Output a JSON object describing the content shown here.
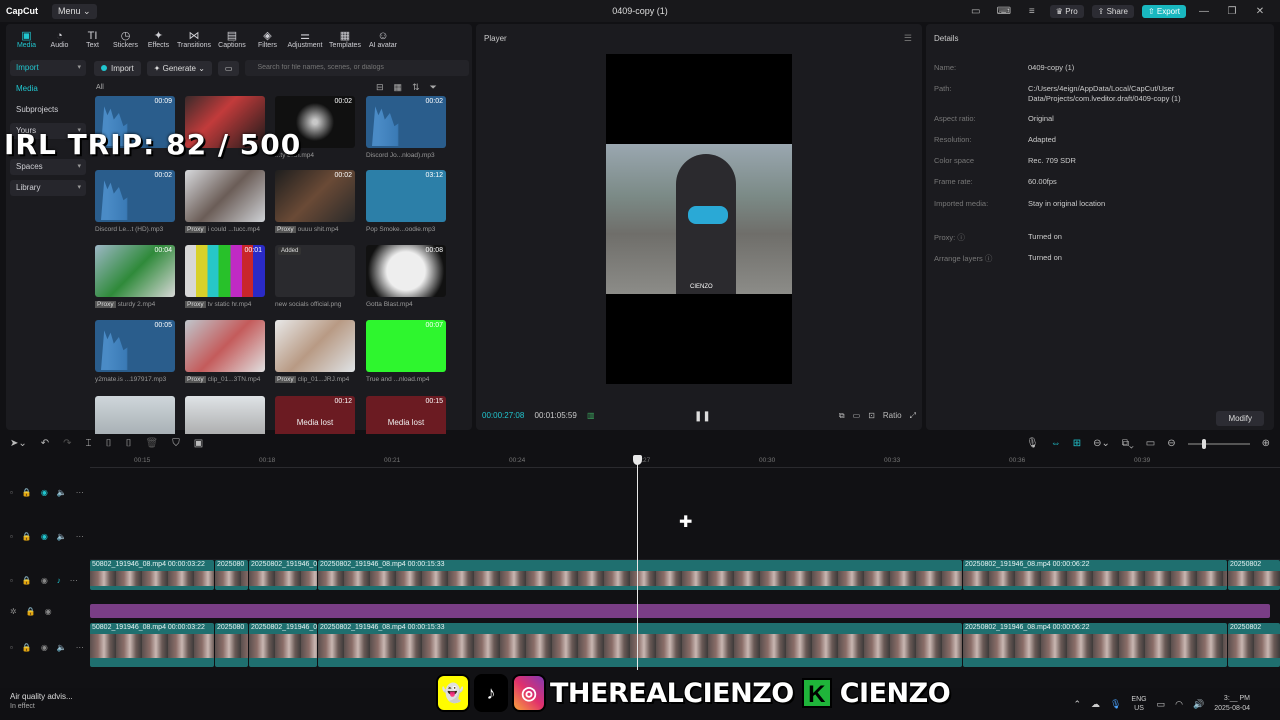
{
  "app": {
    "logo": "CapCut",
    "menu_label": "Menu",
    "title": "0409-copy (1)",
    "pro_label": "Pro",
    "share_label": "Share",
    "export_label": "Export",
    "accent_color": "#19b7bf"
  },
  "toolbar": {
    "items": [
      {
        "label": "Media",
        "icon": "media-icon"
      },
      {
        "label": "Audio",
        "icon": "audio-icon"
      },
      {
        "label": "Text",
        "icon": "text-icon"
      },
      {
        "label": "Stickers",
        "icon": "sticker-icon"
      },
      {
        "label": "Effects",
        "icon": "effects-icon"
      },
      {
        "label": "Transitions",
        "icon": "transitions-icon"
      },
      {
        "label": "Captions",
        "icon": "captions-icon"
      },
      {
        "label": "Filters",
        "icon": "filters-icon"
      },
      {
        "label": "Adjustment",
        "icon": "adjustment-icon"
      },
      {
        "label": "Templates",
        "icon": "templates-icon"
      },
      {
        "label": "AI avatar",
        "icon": "ai-avatar-icon"
      }
    ]
  },
  "sidebar": {
    "items": [
      {
        "label": "Import"
      },
      {
        "label": "Media"
      },
      {
        "label": "Subprojects"
      },
      {
        "label": "Yours"
      },
      {
        "label": "Spaces"
      },
      {
        "label": "Library"
      }
    ]
  },
  "media": {
    "import_label": "Import",
    "generate_label": "Generate",
    "search_placeholder": "Search for file names, scenes, or dialogs",
    "filter_label": "All",
    "proxy_tag": "Proxy",
    "added_tag": "Added",
    "items": [
      {
        "name": "",
        "duration": "00:09"
      },
      {
        "name": "",
        "duration": ""
      },
      {
        "name": "...ty btch.mp4",
        "duration": "00:02"
      },
      {
        "name": "Discord Jo...nload).mp3",
        "duration": "00:02"
      },
      {
        "name": "Discord Le...t (HD).mp3",
        "duration": "00:02"
      },
      {
        "name": "i could ...tucc.mp4",
        "duration": ""
      },
      {
        "name": "ouuu shit.mp4",
        "duration": "00:02"
      },
      {
        "name": "Pop Smoke...oodie.mp3",
        "duration": "03:12"
      },
      {
        "name": "sturdy 2.mp4",
        "duration": "00:04"
      },
      {
        "name": "tv static hr.mp4",
        "duration": "00:01"
      },
      {
        "name": "new socials official.png",
        "duration": ""
      },
      {
        "name": "Gotta Blast.mp4",
        "duration": "00:08"
      },
      {
        "name": "y2mate.is ...197917.mp3",
        "duration": "00:05"
      },
      {
        "name": "clip_01...3TN.mp4",
        "duration": ""
      },
      {
        "name": "clip_01...JRJ.mp4",
        "duration": ""
      },
      {
        "name": "True and ...nload.mp4",
        "duration": "00:07"
      },
      {
        "name": "",
        "duration": ""
      },
      {
        "name": "",
        "duration": ""
      },
      {
        "name": "Media lost",
        "duration": "00:12"
      },
      {
        "name": "Media lost",
        "duration": "00:15"
      }
    ]
  },
  "overlay": {
    "irl_text": "IRL TRIP:  82 / 500",
    "handle_1": "THEREALCIENZO",
    "handle_k": "K",
    "handle_2": "CIENZO"
  },
  "player": {
    "title": "Player",
    "current_time": "00:00:27:08",
    "total_time": "00:01:05:59",
    "ratio_label": "Ratio",
    "watermark": "CIENZO"
  },
  "details": {
    "title": "Details",
    "rows": [
      {
        "label": "Name:",
        "value": "0409-copy (1)"
      },
      {
        "label": "Path:",
        "value": "C:/Users/4eign/AppData/Local/CapCut/User Data/Projects/com.lveditor.draft/0409-copy (1)"
      },
      {
        "label": "Aspect ratio:",
        "value": "Original"
      },
      {
        "label": "Resolution:",
        "value": "Adapted"
      },
      {
        "label": "Color space",
        "value": "Rec. 709 SDR"
      },
      {
        "label": "Frame rate:",
        "value": "60.00fps"
      },
      {
        "label": "Imported media:",
        "value": "Stay in original location"
      },
      {
        "label": "Proxy: ⓘ",
        "value": "Turned on"
      },
      {
        "label": "Arrange layers ⓘ",
        "value": "Turned on"
      }
    ],
    "modify_label": "Modify"
  },
  "timeline": {
    "ruler": [
      "00:15",
      "00:18",
      "00:21",
      "00:24",
      "00:27",
      "00:30",
      "00:33",
      "00:36",
      "00:39"
    ],
    "clips_row1": [
      {
        "label": "50802_191946_08.mp4  00:00:03:22"
      },
      {
        "label": "2025080"
      },
      {
        "label": "20250802_191946_0"
      },
      {
        "label": "20250802_191946_08.mp4  00:00:15:33"
      },
      {
        "label": "20250802_191946_08.mp4  00:00:06:22"
      },
      {
        "label": "20250802"
      }
    ],
    "clips_row2": [
      {
        "label": "50802_191946_08.mp4  00:00:03:22"
      },
      {
        "label": "2025080"
      },
      {
        "label": "20250802_191946_0"
      },
      {
        "label": "20250802_191946_08.mp4  00:00:15:33"
      },
      {
        "label": "20250802_191946_08.mp4  00:00:06:22"
      },
      {
        "label": "20250802"
      }
    ]
  },
  "taskbar": {
    "notif_title": "Air quality advis...",
    "notif_sub": "In effect",
    "lang_top": "ENG",
    "lang_bottom": "US",
    "time": "3:__ PM",
    "date": "2025-08-04"
  }
}
